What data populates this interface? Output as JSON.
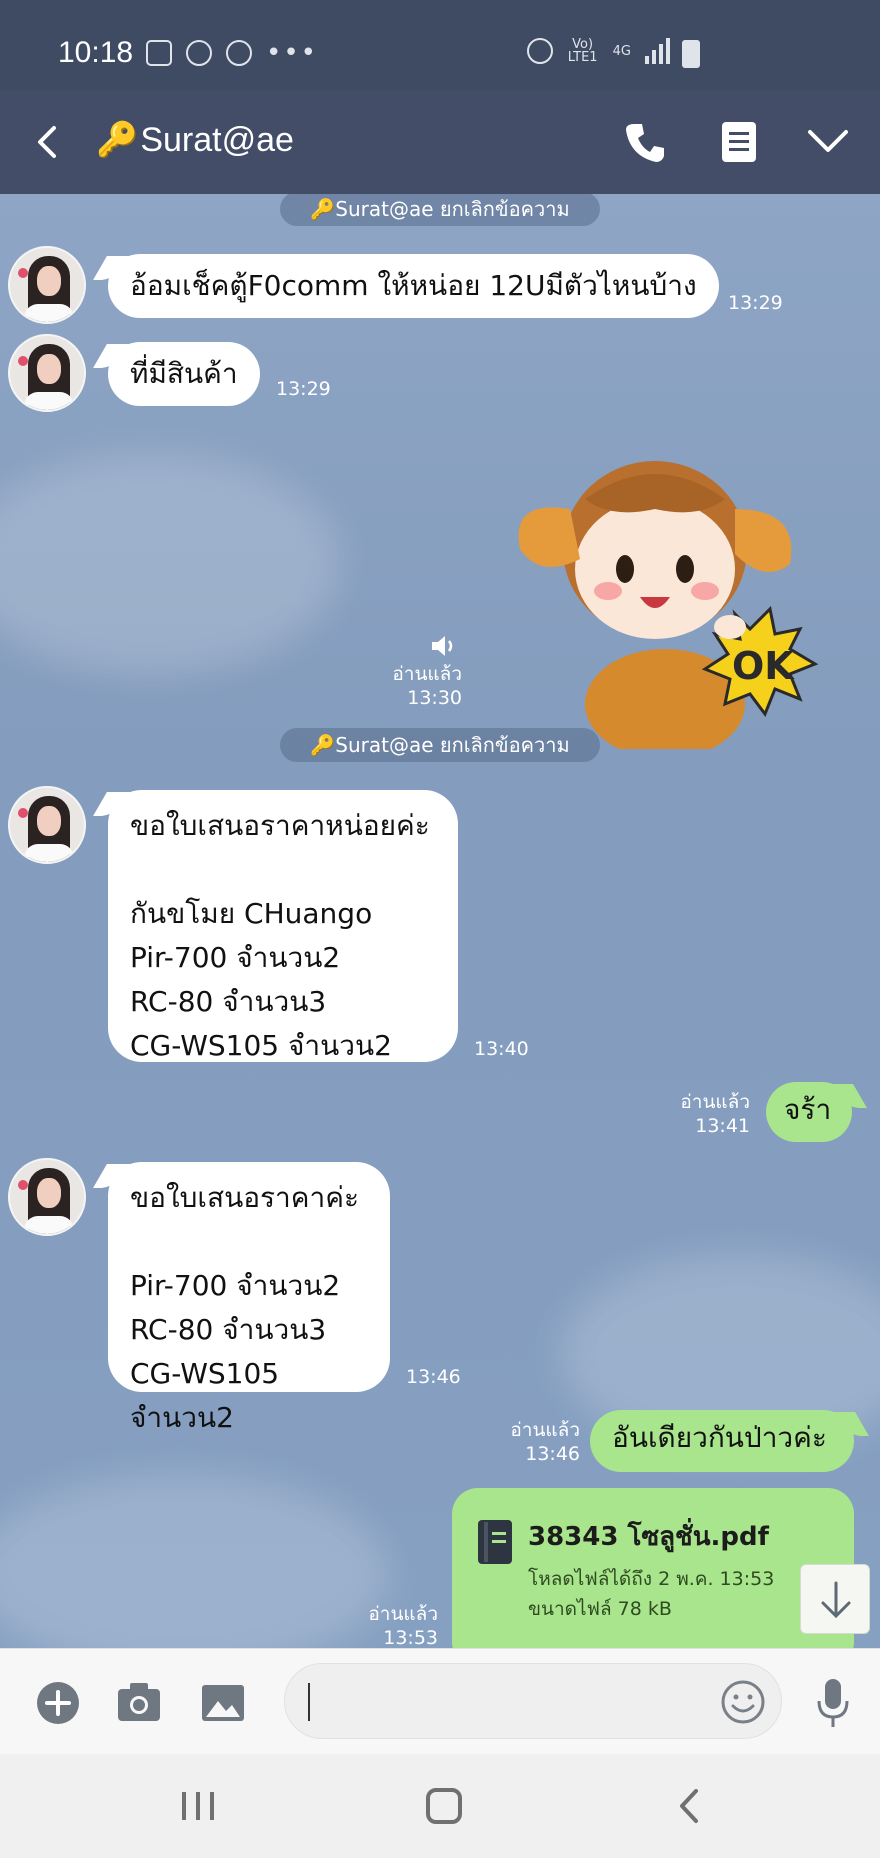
{
  "status_bar": {
    "time": "10:18",
    "network": "Vo) LTE1",
    "network_type": "4G"
  },
  "header": {
    "title": "Surat@ae",
    "key_emoji": "🔑"
  },
  "chat": {
    "notices": [
      {
        "text": "🔑Surat@ae ยกเลิกข้อความ"
      },
      {
        "text": "🔑Surat@ae ยกเลิกข้อความ"
      }
    ],
    "messages": [
      {
        "side": "left",
        "text": "อ้อมเช็คตู้F0comm ให้หน่อย 12Uมีตัวไหนบ้าง",
        "time": "13:29"
      },
      {
        "side": "left",
        "text": "ที่มีสินค้า",
        "time": "13:29"
      },
      {
        "side": "right",
        "type": "sticker",
        "read": "อ่านแล้ว",
        "time": "13:30",
        "sticker_text": "OK"
      },
      {
        "side": "left",
        "text": "ขอใบเสนอราคาหน่อยค่ะ\n\nกันขโมย CHuango\nPir-700 จำนวน2\nRC-80 จำนวน3\nCG-WS105 จำนวน2",
        "time": "13:40"
      },
      {
        "side": "right",
        "text": "จร้า",
        "read": "อ่านแล้ว",
        "time": "13:41"
      },
      {
        "side": "left",
        "text": "ขอใบเสนอราคาค่ะ\n\nPir-700 จำนวน2\nRC-80 จำนวน3\nCG-WS105 จำนวน2",
        "time": "13:46"
      },
      {
        "side": "right",
        "text": "อันเดียวกันป่าวค่ะ",
        "read": "อ่านแล้ว",
        "time": "13:46"
      },
      {
        "side": "right",
        "type": "file",
        "file_name": "38343 โซลูชั่น.pdf",
        "meta": "โหลดไฟล์ได้ถึง 2 พ.ค. 13:53\nขนาดไฟล์ 78 kB",
        "read": "อ่านแล้ว",
        "time": "13:53"
      }
    ]
  },
  "input": {
    "placeholder": ""
  },
  "colors": {
    "header_bg": "#434d67",
    "status_bg": "#3f4a63",
    "chat_bg": "#8aa2c2",
    "outgoing_bubble": "#a9e58c",
    "incoming_bubble": "#ffffff"
  },
  "icons": [
    "back-icon",
    "call-icon",
    "notes-icon",
    "chevron-down-icon",
    "speaker-icon",
    "file-icon",
    "download-icon",
    "plus-icon",
    "camera-icon",
    "image-icon",
    "emoji-icon",
    "mic-icon"
  ]
}
